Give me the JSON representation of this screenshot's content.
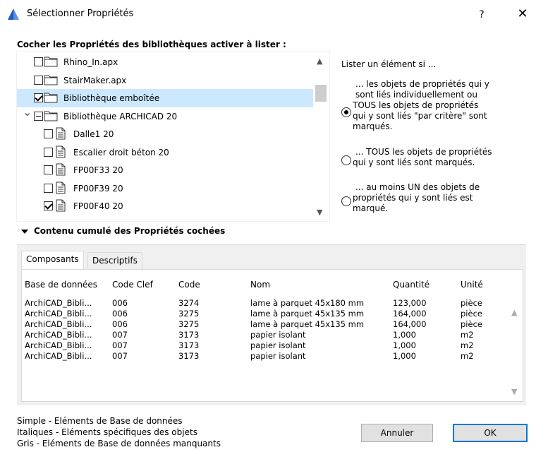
{
  "window": {
    "title": "Sélectionner Propriétés",
    "help": "?",
    "close": "✕",
    "logo_color": "#1e5bbf"
  },
  "tree": {
    "heading": "Cocher les Propriétés des bibliothèques activer à lister :",
    "items": [
      {
        "label": "Rhino_In.apx",
        "state": "unchecked",
        "icon": "folder-icon",
        "level": 0,
        "selected": false
      },
      {
        "label": "StairMaker.apx",
        "state": "unchecked",
        "icon": "folder-icon",
        "level": 0,
        "selected": false
      },
      {
        "label": "Bibliothèque emboîtée",
        "state": "checked",
        "icon": "folder-icon",
        "level": 0,
        "selected": true
      },
      {
        "label": "Bibliothèque ARCHICAD 20",
        "state": "partial",
        "icon": "folder-icon",
        "level": 0,
        "expanded": true,
        "selected": false
      },
      {
        "label": "Dalle1 20",
        "state": "unchecked",
        "icon": "document-icon",
        "level": 1,
        "selected": false
      },
      {
        "label": "Escalier droit béton 20",
        "state": "unchecked",
        "icon": "document-icon",
        "level": 1,
        "selected": false
      },
      {
        "label": "FP00F33 20",
        "state": "unchecked",
        "icon": "document-icon",
        "level": 1,
        "selected": false
      },
      {
        "label": "FP00F39 20",
        "state": "unchecked",
        "icon": "document-icon",
        "level": 1,
        "selected": false
      },
      {
        "label": "FP00F40 20",
        "state": "checked",
        "icon": "document-icon",
        "level": 1,
        "selected": false
      }
    ]
  },
  "right": {
    "list_if": "Lister un élément si ...",
    "options": [
      {
        "lines": [
          "... les objets de propriétés qui y",
          "sont liés individuellement ou",
          "TOUS les objets de propriétés",
          "qui y sont liés \"par critère\" sont",
          "marqués."
        ],
        "selected": true
      },
      {
        "lines": [
          "... TOUS les objets de propriétés",
          "qui y sont liés sont marqués."
        ],
        "selected": false
      },
      {
        "lines": [
          "... au moins UN des objets de",
          "propriétés qui y sont liés est",
          "marqué."
        ],
        "selected": false
      }
    ]
  },
  "cumul": {
    "label": "Contenu cumulé des Propriétés cochées"
  },
  "tabs": {
    "active": "Composants",
    "inactive": "Descriptifs"
  },
  "table": {
    "headers": [
      "Base de données",
      "Code Clef",
      "Code",
      "Nom",
      "Quantité",
      "Unité"
    ],
    "rows": [
      [
        "ArchiCAD_Bibli...",
        "006",
        "3274",
        "lame à parquet 45x180 mm",
        "123,000",
        "pièce"
      ],
      [
        "ArchiCAD_Bibli...",
        "006",
        "3275",
        "lame à parquet 45x135 mm",
        "164,000",
        "pièce"
      ],
      [
        "ArchiCAD_Bibli...",
        "006",
        "3275",
        "lame à parquet 45x135 mm",
        "164,000",
        "pièce"
      ],
      [
        "ArchiCAD_Bibli...",
        "007",
        "3173",
        "papier isolant",
        "1,000",
        "m2"
      ],
      [
        "ArchiCAD_Bibli...",
        "007",
        "3173",
        "papier isolant",
        "1,000",
        "m2"
      ],
      [
        "ArchiCAD_Bibli...",
        "007",
        "3173",
        "papier isolant",
        "1,000",
        "m2"
      ]
    ]
  },
  "legend": [
    "Simple - Eléments de Base de données",
    "Italiques - Eléments spécifiques des objets",
    "Gris - Eléments de Base de données manquants"
  ],
  "buttons": {
    "cancel": "Annuler",
    "ok": "OK",
    "ok_border": "#0078d7"
  }
}
